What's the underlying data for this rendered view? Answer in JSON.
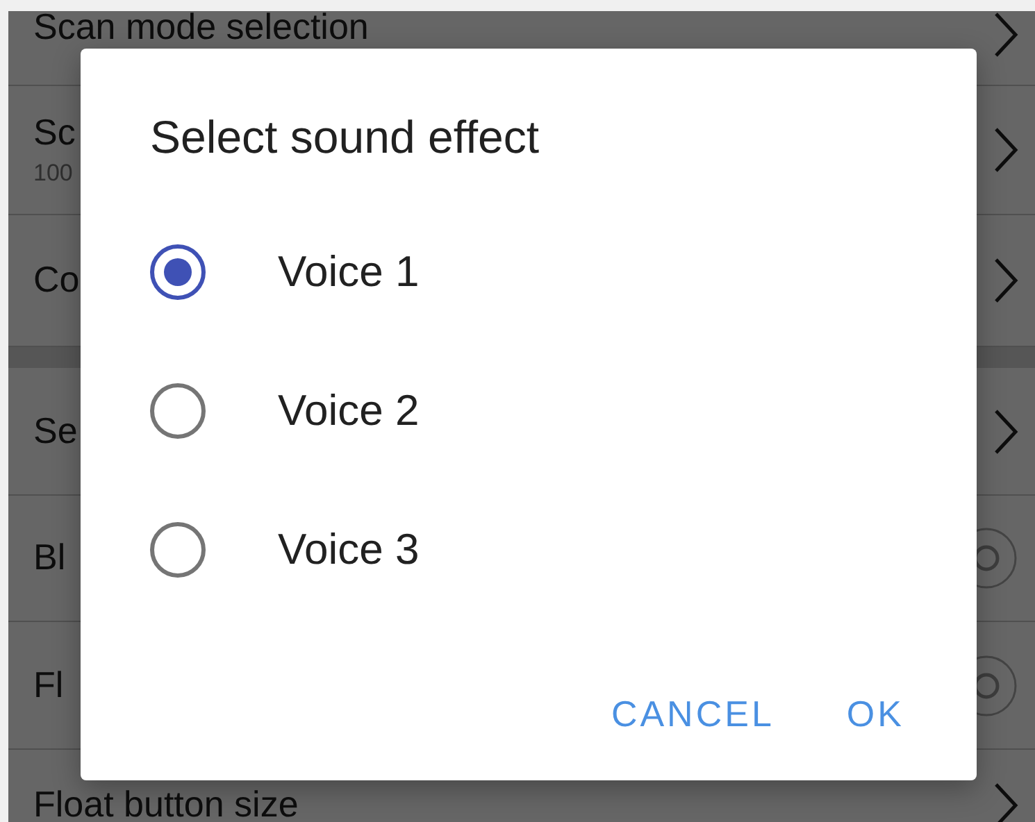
{
  "settings": [
    {
      "kind": "chevron",
      "title": "Scan mode selection"
    },
    {
      "kind": "chevron",
      "title": "Sc",
      "subtitle": "100"
    },
    {
      "kind": "chevron",
      "title": "Co"
    },
    {
      "kind": "section-gap"
    },
    {
      "kind": "chevron",
      "title": "Se"
    },
    {
      "kind": "toggle",
      "title": "Bl"
    },
    {
      "kind": "toggle",
      "title": "Fl"
    },
    {
      "kind": "chevron",
      "title": "Float button size"
    }
  ],
  "dialog": {
    "title": "Select sound effect",
    "options": [
      {
        "label": "Voice 1",
        "selected": true
      },
      {
        "label": "Voice 2",
        "selected": false
      },
      {
        "label": "Voice 3",
        "selected": false
      }
    ],
    "buttons": [
      "CANCEL",
      "OK"
    ]
  }
}
